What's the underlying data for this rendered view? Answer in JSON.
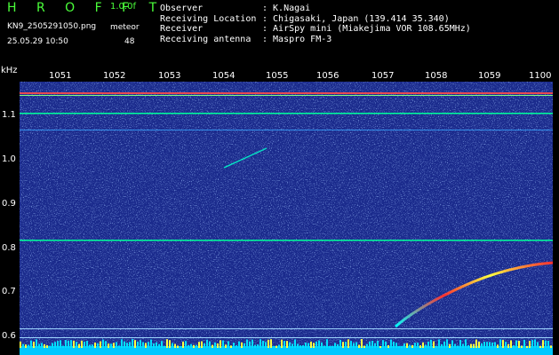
{
  "header": {
    "title": "H R O F F T",
    "version": "1.0.0f",
    "filename": "KN9_2505291050.png",
    "datetime": "25.05.29 10:50",
    "meteor_label": "meteor",
    "meteor_count": "48"
  },
  "info": [
    {
      "key": "Observer",
      "value": ": K.Nagai"
    },
    {
      "key": "Receiving Location",
      "value": ": Chigasaki, Japan (139.414 35.340)"
    },
    {
      "key": "Receiver",
      "value": ": AirSpy mini (Miakejima VOR 108.65MHz)"
    },
    {
      "key": "Receiving antenna",
      "value": ": Maspro FM-3"
    }
  ],
  "time_axis": [
    "1051",
    "1052",
    "1053",
    "1054",
    "1055",
    "1056",
    "1057",
    "1058",
    "1059",
    "1100"
  ],
  "freq_axis": {
    "unit": "kHz",
    "labels": [
      "1.1",
      "1.0",
      "0.9",
      "0.8",
      "0.7",
      "0.6"
    ]
  },
  "colors": {
    "background": "#1a2a8c",
    "axis_bar": "#000000",
    "title": "#4aff3a"
  }
}
